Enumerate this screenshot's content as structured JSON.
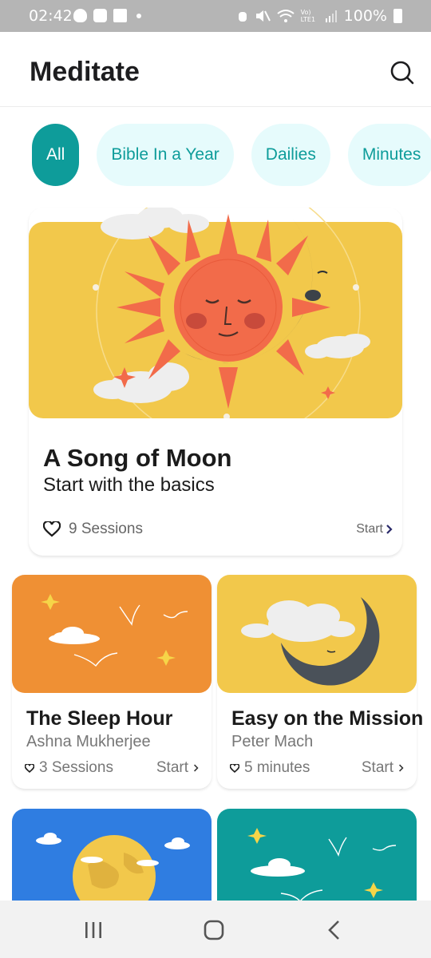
{
  "status": {
    "time": "02:42",
    "battery": "100%",
    "network_label": "Vo) LTE1"
  },
  "header": {
    "title": "Meditate"
  },
  "filters": [
    {
      "label": "All",
      "active": true
    },
    {
      "label": "Bible In a Year",
      "active": false
    },
    {
      "label": "Dailies",
      "active": false
    },
    {
      "label": "Minutes",
      "active": false
    }
  ],
  "featured": {
    "title": "A Song of Moon",
    "subtitle": "Start with the basics",
    "sessions": "9 Sessions",
    "start": "Start",
    "art_color": "#f2c84b"
  },
  "cards": [
    {
      "title": "The Sleep Hour",
      "author": "Ashna Mukherjee",
      "meta": "3 Sessions",
      "start": "Start",
      "art_color": "#ef9034"
    },
    {
      "title": "Easy on the Mission",
      "author": "Peter Mach",
      "meta": "5 minutes",
      "start": "Start",
      "art_color": "#f2c84b"
    }
  ],
  "more_cards": [
    {
      "art_color": "#2f7de1"
    },
    {
      "art_color": "#0e9c9a"
    }
  ],
  "colors": {
    "accent": "#0e9c9a",
    "chip_bg": "#e6fbfc",
    "status_bar": "#b5b5b5"
  }
}
